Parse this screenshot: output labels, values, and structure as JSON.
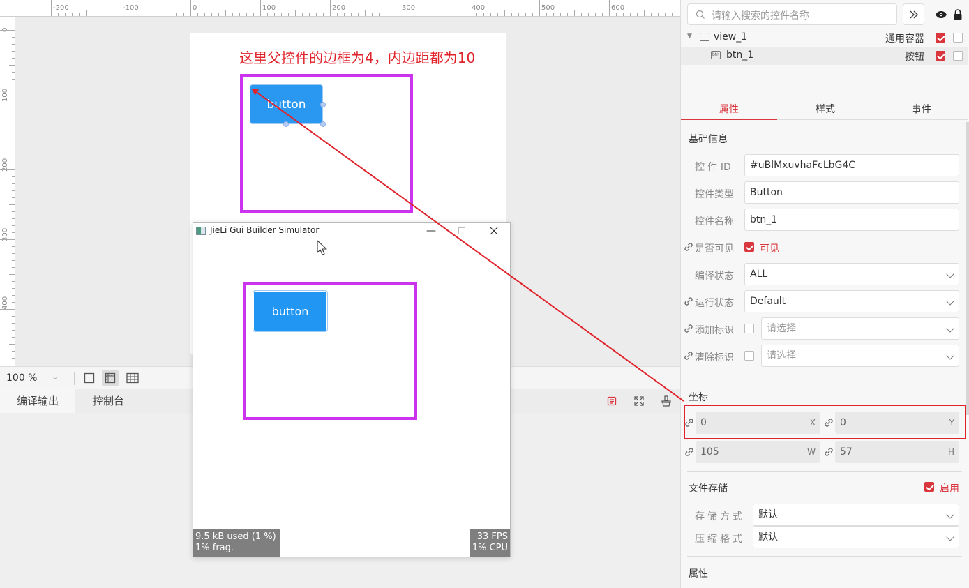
{
  "canvas": {
    "ruler_top_labels": [
      "-200",
      "-100",
      "0",
      "100",
      "200",
      "300",
      "400",
      "500",
      "600"
    ],
    "ruler_left_labels": [
      "0",
      "100",
      "200",
      "300",
      "400"
    ],
    "note_text": "这里父控件的边框为4，内边距都为10",
    "design_button_label": "button"
  },
  "canvas_statusbar": {
    "zoom": "100 %",
    "icons": [
      "single-view-icon",
      "ruler-view-icon",
      "grid-view-icon"
    ]
  },
  "output_panel": {
    "tabs": [
      "编译输出",
      "控制台"
    ],
    "icons": [
      "clear-log-icon",
      "expand-icon",
      "clean-icon"
    ]
  },
  "simulator": {
    "title": "JieLi Gui Builder Simulator",
    "button_label": "button",
    "mem_line1": "9.5 kB used (1 %)",
    "mem_line2": "1% frag.",
    "fps_line1": "33 FPS",
    "fps_line2": "1% CPU"
  },
  "right_panel": {
    "search_placeholder": "请输入搜索的控件名称",
    "tree": [
      {
        "name": "view_1",
        "type": "通用容器",
        "visible": true,
        "locked": false
      },
      {
        "name": "btn_1",
        "type": "按钮",
        "visible": true,
        "locked": false
      }
    ],
    "tabs": [
      "属性",
      "样式",
      "事件"
    ],
    "basic_section": "基础信息",
    "fields": {
      "id_label": "控 件 ID",
      "id_value": "#uBlMxuvhaFcLbG4C",
      "type_label": "控件类型",
      "type_value": "Button",
      "name_label": "控件名称",
      "name_value": "btn_1",
      "visible_label": "是否可见",
      "visible_value": "可见",
      "compile_label": "编译状态",
      "compile_value": "ALL",
      "run_label": "运行状态",
      "run_value": "Default",
      "add_flag_label": "添加标识",
      "add_flag_value": "请选择",
      "clear_flag_label": "清除标识",
      "clear_flag_value": "请选择"
    },
    "coord_section": "坐标",
    "coords": {
      "x": "0",
      "x_unit": "X",
      "y": "0",
      "y_unit": "Y",
      "w": "105",
      "w_unit": "W",
      "h": "57",
      "h_unit": "H"
    },
    "storage_section": "文件存储",
    "storage_enable": "启用",
    "storage_mode_label": "存储方式",
    "storage_mode_value": "默认",
    "compress_label": "压缩格式",
    "compress_value": "默认",
    "attr_section": "属性"
  },
  "colors": {
    "accent": "#d9363e",
    "annotation_red": "#e0222a",
    "border_purple": "#cc33ee",
    "button_blue": "#2196f3"
  }
}
